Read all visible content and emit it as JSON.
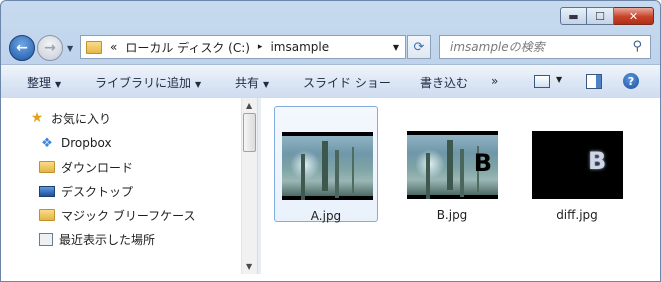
{
  "window": {
    "buttons": {
      "minimize": "▬",
      "maximize": "☐",
      "close": "✕"
    }
  },
  "address": {
    "overflow": "«",
    "segments": [
      "ローカル ディスク (C:)",
      "imsample"
    ],
    "separator": "▸"
  },
  "search": {
    "placeholder": "imsampleの検索"
  },
  "toolbar": {
    "items": [
      {
        "label": "整理",
        "dropdown": true
      },
      {
        "label": "ライブラリに追加",
        "dropdown": true
      },
      {
        "label": "共有",
        "dropdown": true
      },
      {
        "label": "スライド ショー",
        "dropdown": false
      },
      {
        "label": "書き込む",
        "dropdown": false
      }
    ],
    "more": "»",
    "help": "?"
  },
  "sidebar": {
    "items": [
      {
        "label": "お気に入り",
        "icon": "star-icon"
      },
      {
        "label": "Dropbox",
        "icon": "dropbox-icon"
      },
      {
        "label": "ダウンロード",
        "icon": "download-folder-icon"
      },
      {
        "label": "デスクトップ",
        "icon": "desktop-icon"
      },
      {
        "label": "マジック ブリーフケース",
        "icon": "briefcase-folder-icon"
      },
      {
        "label": "最近表示した場所",
        "icon": "recent-places-icon"
      }
    ]
  },
  "files": [
    {
      "name": "A.jpg",
      "selected": true
    },
    {
      "name": "B.jpg",
      "selected": false,
      "overlay": "B"
    },
    {
      "name": "diff.jpg",
      "selected": false,
      "overlay": "B"
    }
  ],
  "colors": {
    "accent": "#3b6fb5",
    "selection": "#84acdd",
    "close": "#c7422a"
  }
}
